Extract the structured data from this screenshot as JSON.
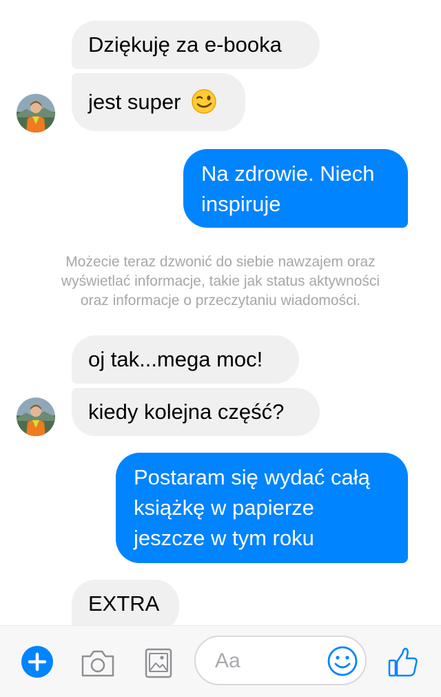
{
  "messages": [
    {
      "from": "them",
      "text": "Dziękuję za e-booka"
    },
    {
      "from": "them",
      "text": "jest super",
      "emoji": "winking-face"
    },
    {
      "from": "me",
      "lines": [
        "Na zdrowie. Niech",
        "inspiruje"
      ]
    },
    {
      "from": "them",
      "text": "oj tak...mega moc!"
    },
    {
      "from": "them",
      "text": "kiedy kolejna część?"
    },
    {
      "from": "me",
      "lines": [
        "Postaram się wydać całą",
        "książkę w papierze",
        "jeszcze w tym roku"
      ]
    },
    {
      "from": "them",
      "text": "EXTRA"
    }
  ],
  "system_notice": {
    "lines": [
      "Możecie teraz dzwonić do siebie nawzajem oraz",
      "wyświetlać informacje, takie jak status aktywności",
      "oraz informacje o przeczytaniu wiadomości."
    ]
  },
  "composer": {
    "placeholder": "Aa",
    "buttons": [
      "plus-icon",
      "camera-icon",
      "gallery-icon",
      "emoji-icon",
      "thumbs-up-icon"
    ]
  },
  "colors": {
    "accent": "#0084ff",
    "incoming_bubble": "#f1f0f0",
    "notice_text": "#a7a7ab",
    "composer_bg": "#f7f7f8"
  }
}
